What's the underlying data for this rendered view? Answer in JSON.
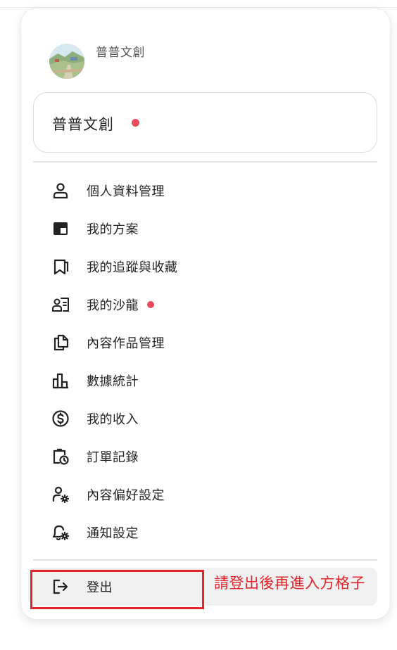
{
  "profile": {
    "name": "普普文創",
    "avatar_icon": "landscape-avatar-image"
  },
  "channel": {
    "name": "普普文創",
    "has_notification": true
  },
  "menu": [
    {
      "label": "個人資料管理",
      "icon": "person-icon",
      "dot": false
    },
    {
      "label": "我的方案",
      "icon": "plan-card-icon",
      "dot": false
    },
    {
      "label": "我的追蹤與收藏",
      "icon": "bookmark-icon",
      "dot": false
    },
    {
      "label": "我的沙龍",
      "icon": "salon-icon",
      "dot": true
    },
    {
      "label": "內容作品管理",
      "icon": "documents-icon",
      "dot": false
    },
    {
      "label": "數據統計",
      "icon": "bar-chart-icon",
      "dot": false
    },
    {
      "label": "我的收入",
      "icon": "dollar-icon",
      "dot": false
    },
    {
      "label": "訂單記錄",
      "icon": "order-clock-icon",
      "dot": false
    },
    {
      "label": "內容偏好設定",
      "icon": "user-gear-icon",
      "dot": false
    },
    {
      "label": "通知設定",
      "icon": "bell-gear-icon",
      "dot": false
    }
  ],
  "logout": {
    "label": "登出",
    "icon": "logout-icon"
  },
  "annotation": {
    "text": "請登出後再進入方格子",
    "color": "#e0252c"
  },
  "colors": {
    "notification_dot": "#e84c5b",
    "logout_bg": "#f1f1f1"
  }
}
